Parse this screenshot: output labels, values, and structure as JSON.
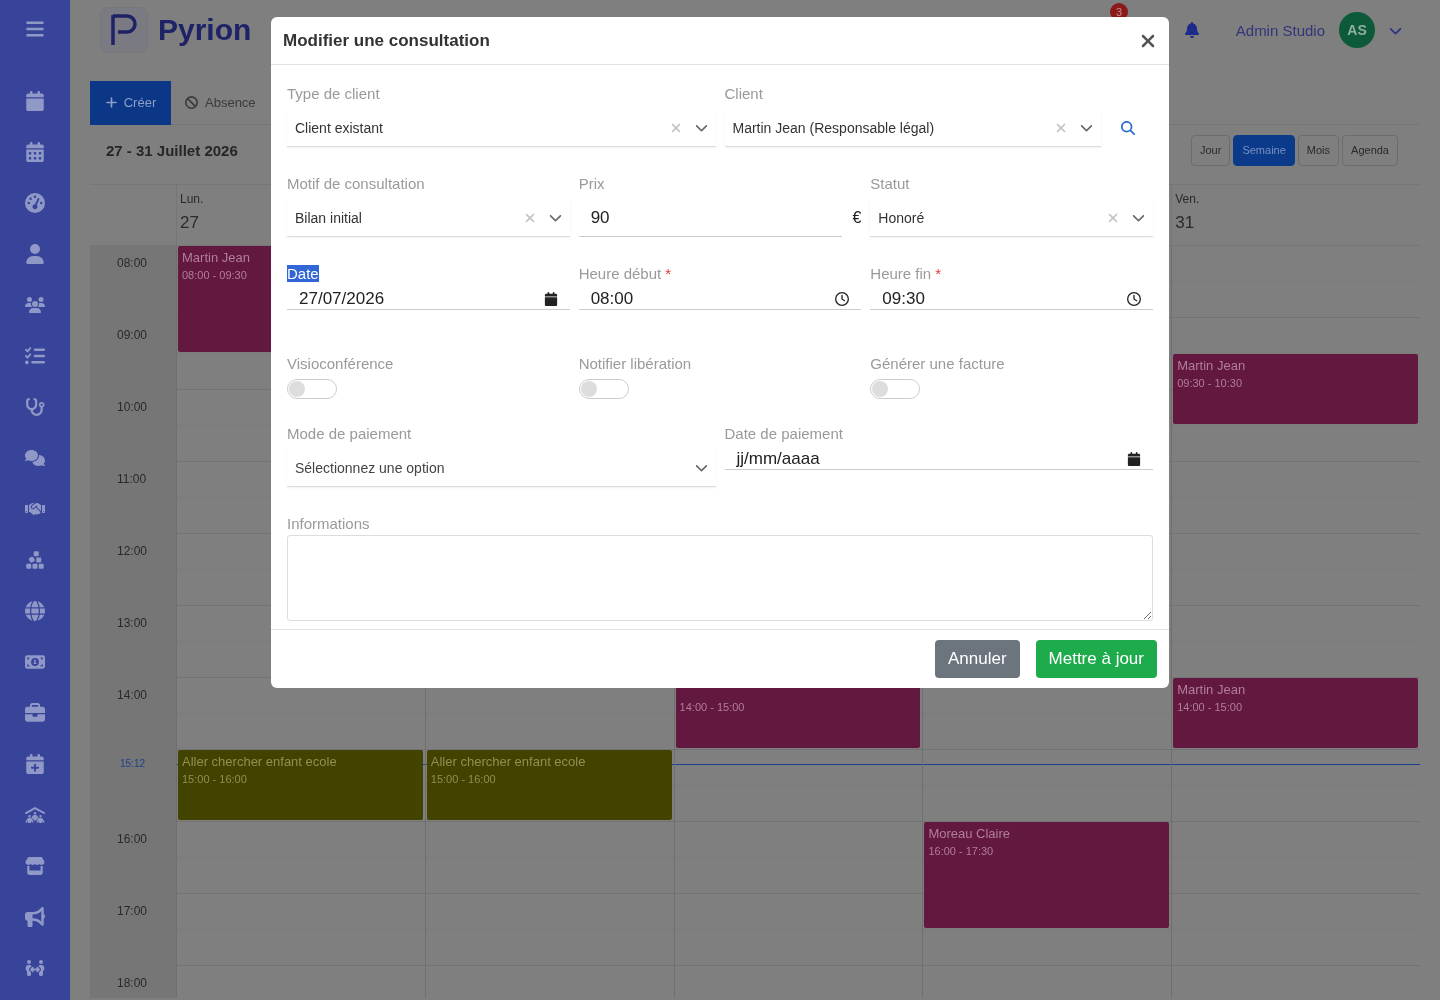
{
  "header": {
    "logo_text": "Pyrion",
    "notification_count": "3",
    "user_name": "Admin Studio",
    "avatar_initials": "AS"
  },
  "toolbar": {
    "create_button": "Créer",
    "absence_button": "Absence",
    "date_range": "27 - 31 Juillet 2026",
    "views": [
      {
        "label": "Jour",
        "selected": false
      },
      {
        "label": "Semaine",
        "selected": true
      },
      {
        "label": "Mois",
        "selected": false
      },
      {
        "label": "Agenda",
        "selected": false
      }
    ]
  },
  "calendar": {
    "hours": [
      "08:00",
      "09:00",
      "10:00",
      "11:00",
      "12:00",
      "13:00",
      "14:00",
      "16:00",
      "17:00",
      "18:00"
    ],
    "now": "15:12",
    "days": [
      {
        "name": "Lun.",
        "date": "27",
        "events": [
          {
            "title": "Martin Jean",
            "time": "08:00 - 09:30",
            "color": "#63183f"
          },
          {
            "title": "Aller chercher enfant ecole",
            "time": "15:00 - 16:00",
            "color": "#434300"
          }
        ]
      },
      {
        "events": [
          {
            "title": "Aller chercher enfant ecole",
            "time": "15:00 - 16:00",
            "color": "#434300"
          }
        ]
      },
      {
        "events": [
          {
            "time": "14:00 - 15:00",
            "color": "#63183f"
          }
        ]
      },
      {
        "events": [
          {
            "title": "Moreau Claire",
            "time": "16:00 - 17:30",
            "color": "#63183f"
          }
        ]
      },
      {
        "name": "Ven.",
        "date": "31",
        "events": [
          {
            "title": "Martin Jean",
            "time": "09:30 - 10:30",
            "color": "#63183f"
          },
          {
            "title": "Martin Jean",
            "time": "14:00 - 15:00",
            "color": "#63183f"
          }
        ]
      }
    ]
  },
  "modal": {
    "title": "Modifier une consultation",
    "rows": [
      {
        "fields": [
          {
            "kind": "select",
            "label": "Type de client",
            "value": "Client existant",
            "clearable": true
          },
          {
            "kind": "select",
            "label": "Client",
            "value": "Martin Jean (Responsable légal)",
            "clearable": true,
            "search": true
          }
        ]
      },
      {
        "fields": [
          {
            "kind": "select",
            "label": "Motif de consultation",
            "value": "Bilan initial",
            "clearable": true
          },
          {
            "kind": "number",
            "label": "Prix",
            "value": "90",
            "suffix": "€"
          },
          {
            "kind": "select",
            "label": "Statut",
            "value": "Honoré",
            "clearable": true
          }
        ]
      },
      {
        "fields": [
          {
            "kind": "date",
            "label": "Date",
            "value": "27/07/2026",
            "highlighted": true
          },
          {
            "kind": "time",
            "label": "Heure début",
            "required_mark": "*",
            "value": "08:00"
          },
          {
            "kind": "time",
            "label": "Heure fin",
            "required_mark": "*",
            "value": "09:30"
          }
        ]
      },
      {
        "fields": [
          {
            "kind": "toggle",
            "label": "Visioconférence",
            "on": false
          },
          {
            "kind": "toggle",
            "label": "Notifier libération",
            "on": false
          },
          {
            "kind": "toggle",
            "label": "Générer une facture",
            "on": false
          }
        ]
      },
      {
        "fields": [
          {
            "kind": "select",
            "label": "Mode de paiement",
            "placeholder": "Sélectionnez une option"
          },
          {
            "kind": "date",
            "label": "Date de paiement",
            "value": "jj/mm/aaaa"
          }
        ]
      },
      {
        "fields": [
          {
            "kind": "textarea",
            "label": "Informations"
          }
        ]
      }
    ],
    "buttons": [
      {
        "kind": "secondary",
        "label": "Annuler"
      },
      {
        "kind": "primary",
        "label": "Mettre à jour"
      }
    ]
  }
}
